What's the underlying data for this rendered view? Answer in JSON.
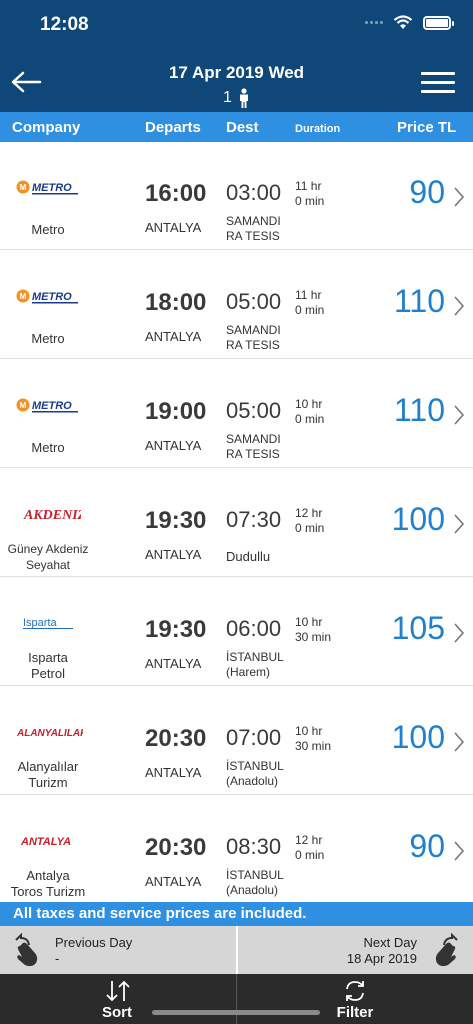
{
  "status_bar": {
    "time": "12:08"
  },
  "nav": {
    "title": "17 Apr 2019 Wed",
    "passengers": "1"
  },
  "columns": {
    "company": "Company",
    "departs": "Departs",
    "dest": "Dest",
    "duration": "Duration",
    "price": "Price TL"
  },
  "trips": [
    {
      "logo": "METRO",
      "company_line1": "Metro",
      "company_line2": "",
      "dep_time": "16:00",
      "dep_city": "ANTALYA",
      "arr_time": "03:00",
      "dest_line1": "SAMANDI",
      "dest_line2": "RA TESIS",
      "dur_line1": "11 hr",
      "dur_line2": "0 min",
      "price": "90"
    },
    {
      "logo": "METRO",
      "company_line1": "Metro",
      "company_line2": "",
      "dep_time": "18:00",
      "dep_city": "ANTALYA",
      "arr_time": "05:00",
      "dest_line1": "SAMANDI",
      "dest_line2": "RA TESIS",
      "dur_line1": "11 hr",
      "dur_line2": "0 min",
      "price": "110"
    },
    {
      "logo": "METRO",
      "company_line1": "Metro",
      "company_line2": "",
      "dep_time": "19:00",
      "dep_city": "ANTALYA",
      "arr_time": "05:00",
      "dest_line1": "SAMANDI",
      "dest_line2": "RA TESIS",
      "dur_line1": "10 hr",
      "dur_line2": "0 min",
      "price": "110"
    },
    {
      "logo": "AKDENIZ",
      "company_line1": "Güney Akdeniz",
      "company_line2": "Seyahat",
      "dep_time": "19:30",
      "dep_city": "ANTALYA",
      "arr_time": "07:30",
      "dest_line1": "Dudullu",
      "dest_line2": "",
      "dur_line1": "12 hr",
      "dur_line2": "0 min",
      "price": "100"
    },
    {
      "logo": "Isparta",
      "company_line1": "Isparta",
      "company_line2": "Petrol",
      "dep_time": "19:30",
      "dep_city": "ANTALYA",
      "arr_time": "06:00",
      "dest_line1": "İSTANBUL",
      "dest_line2": "(Harem)",
      "dur_line1": "10 hr",
      "dur_line2": "30 min",
      "price": "105"
    },
    {
      "logo": "ALANYALILAR",
      "company_line1": "Alanyalılar",
      "company_line2": "Turizm",
      "dep_time": "20:30",
      "dep_city": "ANTALYA",
      "arr_time": "07:00",
      "dest_line1": "İSTANBUL",
      "dest_line2": "(Anadolu)",
      "dur_line1": "10 hr",
      "dur_line2": "30 min",
      "price": "100"
    },
    {
      "logo": "ANTALYA",
      "company_line1": "Antalya",
      "company_line2": "Toros Turizm",
      "dep_time": "20:30",
      "dep_city": "ANTALYA",
      "arr_time": "08:30",
      "dest_line1": "İSTANBUL",
      "dest_line2": "(Anadolu)",
      "dur_line1": "12 hr",
      "dur_line2": "0 min",
      "price": "90"
    }
  ],
  "banner": {
    "text": "All taxes and service prices are included."
  },
  "day_nav": {
    "prev_label": "Previous Day",
    "prev_value": "-",
    "next_label": "Next Day",
    "next_value": "18 Apr 2019"
  },
  "toolbar": {
    "sort_label": "Sort",
    "filter_label": "Filter"
  },
  "colors": {
    "header": "#0f4778",
    "accent": "#2f8fe0",
    "price": "#1e80cf",
    "toolbar": "#2b2b2b"
  }
}
